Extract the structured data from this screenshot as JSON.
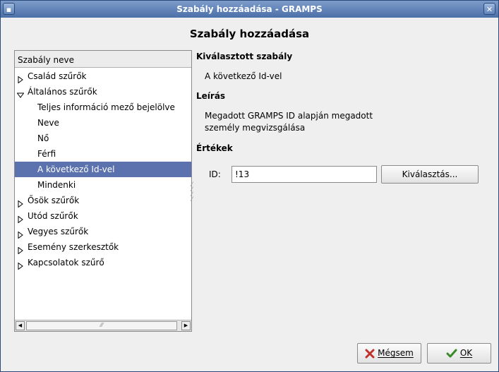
{
  "window": {
    "title": "Szabály hozzáadása - GRAMPS",
    "close_glyph": "✕",
    "min_glyph": "▪"
  },
  "heading": "Szabály hozzáadása",
  "tree": {
    "column_header": "Szabály neve",
    "items": [
      {
        "label": "Család szűrők",
        "level": 0,
        "expander": "collapsed"
      },
      {
        "label": "Általános szűrők",
        "level": 0,
        "expander": "expanded"
      },
      {
        "label": "Teljes információ mező bejelölve",
        "level": 1
      },
      {
        "label": "Neve",
        "level": 1
      },
      {
        "label": "Nő",
        "level": 1
      },
      {
        "label": "Férfi",
        "level": 1
      },
      {
        "label": "A következő Id-vel",
        "level": 1,
        "selected": true
      },
      {
        "label": "Mindenki",
        "level": 1
      },
      {
        "label": "Ősök szűrők",
        "level": 0,
        "expander": "collapsed"
      },
      {
        "label": "Utód szűrők",
        "level": 0,
        "expander": "collapsed"
      },
      {
        "label": "Vegyes szűrők",
        "level": 0,
        "expander": "collapsed"
      },
      {
        "label": "Esemény szerkesztők",
        "level": 0,
        "expander": "collapsed"
      },
      {
        "label": "Kapcsolatok szűrő",
        "level": 0,
        "expander": "collapsed"
      }
    ]
  },
  "detail": {
    "selected_rule_heading": "Kiválasztott szabály",
    "selected_rule": "A következő Id-vel",
    "description_heading": "Leírás",
    "description_line1": "Megadott GRAMPS ID alapján megadott",
    "description_line2": "személy megvizsgálása",
    "values_heading": "Értékek",
    "id_label": "ID:",
    "id_value": "!13",
    "select_button": "Kiválasztás..."
  },
  "buttons": {
    "cancel": "Mégsem",
    "ok": "OK"
  },
  "colors": {
    "selection": "#5b72ae",
    "titlebar": "#4b6fa8",
    "cancel_icon": "#c0302c",
    "ok_icon": "#3a8a2a"
  }
}
